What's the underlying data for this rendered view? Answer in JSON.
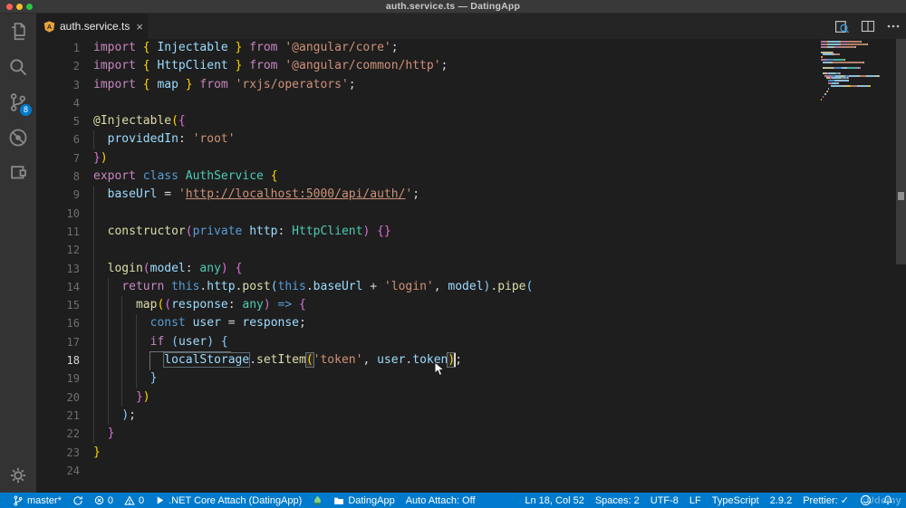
{
  "window": {
    "title": "auth.service.ts — DatingApp"
  },
  "colors": {
    "accent": "#007ACC",
    "badge_bg": "#007ACC",
    "flame": "#89D185",
    "angular_icon": "#E8A33D"
  },
  "palette": {
    "kw": "#C586C0",
    "st": "#569CD6",
    "fn": "#DCDCAA",
    "ty": "#4EC9B0",
    "va": "#9CDCFE",
    "sr": "#CE9178",
    "pu": "#D4D4D4",
    "b1": "#FFD602",
    "b2": "#DA70D6",
    "b3": "#87CEFA"
  },
  "activity_bar": {
    "items": [
      {
        "icon": "files",
        "badge": ""
      },
      {
        "icon": "search",
        "badge": ""
      },
      {
        "icon": "source-control",
        "badge": "8"
      },
      {
        "icon": "debug",
        "badge": ""
      },
      {
        "icon": "extensions",
        "badge": ""
      }
    ],
    "bottom": [
      {
        "icon": "settings",
        "badge": ""
      }
    ]
  },
  "tab": {
    "label": "auth.service.ts",
    "close": "×"
  },
  "editor_actions": [
    {
      "icon": "open-preview"
    },
    {
      "icon": "split-editor"
    },
    {
      "icon": "more-actions"
    }
  ],
  "code": {
    "active_line": 18,
    "lines": [
      {
        "n": 1,
        "i": 0,
        "g": 0,
        "t": [
          [
            "import ",
            "kw"
          ],
          [
            "{",
            "b1"
          ],
          [
            " Injectable ",
            "va"
          ],
          [
            "}",
            "b1"
          ],
          [
            " from ",
            "kw"
          ],
          [
            "'@angular/core'",
            "sr"
          ],
          [
            ";",
            "pu"
          ]
        ]
      },
      {
        "n": 2,
        "i": 0,
        "g": 0,
        "t": [
          [
            "import ",
            "kw"
          ],
          [
            "{",
            "b1"
          ],
          [
            " HttpClient ",
            "va"
          ],
          [
            "}",
            "b1"
          ],
          [
            " from ",
            "kw"
          ],
          [
            "'@angular/common/http'",
            "sr"
          ],
          [
            ";",
            "pu"
          ]
        ]
      },
      {
        "n": 3,
        "i": 0,
        "g": 0,
        "t": [
          [
            "import ",
            "kw"
          ],
          [
            "{",
            "b1"
          ],
          [
            " map ",
            "va"
          ],
          [
            "}",
            "b1"
          ],
          [
            " from ",
            "kw"
          ],
          [
            "'rxjs/operators'",
            "sr"
          ],
          [
            ";",
            "pu"
          ]
        ]
      },
      {
        "n": 4,
        "i": 0,
        "g": 0,
        "t": []
      },
      {
        "n": 5,
        "i": 0,
        "g": 0,
        "t": [
          [
            "@Injectable",
            "fn"
          ],
          [
            "(",
            "b1"
          ],
          [
            "{",
            "b2"
          ]
        ]
      },
      {
        "n": 6,
        "i": 2,
        "g": 1,
        "t": [
          [
            "providedIn",
            "va"
          ],
          [
            ": ",
            "pu"
          ],
          [
            "'root'",
            "sr"
          ]
        ]
      },
      {
        "n": 7,
        "i": 0,
        "g": 0,
        "t": [
          [
            "}",
            "b2"
          ],
          [
            ")",
            "b1"
          ]
        ]
      },
      {
        "n": 8,
        "i": 0,
        "g": 0,
        "t": [
          [
            "export ",
            "kw"
          ],
          [
            "class ",
            "st"
          ],
          [
            "AuthService ",
            "ty"
          ],
          [
            "{",
            "b1"
          ]
        ]
      },
      {
        "n": 9,
        "i": 2,
        "g": 1,
        "t": [
          [
            "baseUrl",
            "va"
          ],
          [
            " = ",
            "pu"
          ],
          [
            "'",
            "sr"
          ],
          [
            "http://localhost:5000/api/auth/",
            "sr",
            "u"
          ],
          [
            "'",
            "sr"
          ],
          [
            ";",
            "pu"
          ]
        ]
      },
      {
        "n": 10,
        "i": 0,
        "g": 1,
        "t": []
      },
      {
        "n": 11,
        "i": 2,
        "g": 1,
        "t": [
          [
            "constructor",
            "fn"
          ],
          [
            "(",
            "b2"
          ],
          [
            "private ",
            "st"
          ],
          [
            "http",
            "va"
          ],
          [
            ": ",
            "pu"
          ],
          [
            "HttpClient",
            "ty"
          ],
          [
            ")",
            "b2"
          ],
          [
            " ",
            "pu"
          ],
          [
            "{}",
            "b2"
          ]
        ]
      },
      {
        "n": 12,
        "i": 0,
        "g": 1,
        "t": []
      },
      {
        "n": 13,
        "i": 2,
        "g": 1,
        "t": [
          [
            "login",
            "fn"
          ],
          [
            "(",
            "b2"
          ],
          [
            "model",
            "va"
          ],
          [
            ": ",
            "pu"
          ],
          [
            "any",
            "ty"
          ],
          [
            ")",
            "b2"
          ],
          [
            " ",
            "pu"
          ],
          [
            "{",
            "b2"
          ]
        ]
      },
      {
        "n": 14,
        "i": 4,
        "g": 2,
        "t": [
          [
            "return ",
            "kw"
          ],
          [
            "this",
            "st"
          ],
          [
            ".",
            "pu"
          ],
          [
            "http",
            "va"
          ],
          [
            ".",
            "pu"
          ],
          [
            "post",
            "fn"
          ],
          [
            "(",
            "b3"
          ],
          [
            "this",
            "st"
          ],
          [
            ".",
            "pu"
          ],
          [
            "baseUrl",
            "va"
          ],
          [
            " + ",
            "pu"
          ],
          [
            "'login'",
            "sr"
          ],
          [
            ", ",
            "pu"
          ],
          [
            "model",
            "va"
          ],
          [
            ")",
            "b3"
          ],
          [
            ".",
            "pu"
          ],
          [
            "pipe",
            "fn"
          ],
          [
            "(",
            "b3"
          ]
        ]
      },
      {
        "n": 15,
        "i": 6,
        "g": 3,
        "t": [
          [
            "map",
            "fn"
          ],
          [
            "(",
            "b1"
          ],
          [
            "(",
            "b2"
          ],
          [
            "response",
            "va"
          ],
          [
            ": ",
            "pu"
          ],
          [
            "any",
            "ty"
          ],
          [
            ")",
            "b2"
          ],
          [
            " ",
            "pu"
          ],
          [
            "=>",
            "st"
          ],
          [
            " ",
            "pu"
          ],
          [
            "{",
            "b2"
          ]
        ]
      },
      {
        "n": 16,
        "i": 8,
        "g": 4,
        "t": [
          [
            "const ",
            "st"
          ],
          [
            "user",
            "va"
          ],
          [
            " = ",
            "pu"
          ],
          [
            "response",
            "va"
          ],
          [
            ";",
            "pu"
          ]
        ]
      },
      {
        "n": 17,
        "i": 8,
        "g": 4,
        "t": [
          [
            "if ",
            "kw"
          ],
          [
            "(",
            "b3"
          ],
          [
            "user",
            "va"
          ],
          [
            ")",
            "b3"
          ],
          [
            " ",
            "pu"
          ],
          [
            "{",
            "b3"
          ]
        ]
      },
      {
        "n": 18,
        "i": 10,
        "g": 4,
        "t": [
          [
            "localStorage",
            "va",
            "w"
          ],
          [
            ".",
            "pu"
          ],
          [
            "setItem",
            "fn"
          ],
          [
            "(",
            "b1",
            "m"
          ],
          [
            "'token'",
            "sr"
          ],
          [
            ", ",
            "pu"
          ],
          [
            "user",
            "va"
          ],
          [
            ".",
            "pu"
          ],
          [
            "token",
            "va"
          ],
          [
            ")",
            "b1",
            "m"
          ],
          [
            ";",
            "pu",
            "c"
          ]
        ]
      },
      {
        "n": 19,
        "i": 8,
        "g": 4,
        "t": [
          [
            "}",
            "b3"
          ]
        ]
      },
      {
        "n": 20,
        "i": 6,
        "g": 3,
        "t": [
          [
            "}",
            "b2"
          ],
          [
            ")",
            "b1"
          ]
        ]
      },
      {
        "n": 21,
        "i": 4,
        "g": 2,
        "t": [
          [
            ")",
            "b3"
          ],
          [
            ";",
            "pu"
          ]
        ]
      },
      {
        "n": 22,
        "i": 2,
        "g": 1,
        "t": [
          [
            "}",
            "b2"
          ]
        ]
      },
      {
        "n": 23,
        "i": 0,
        "g": 0,
        "t": [
          [
            "}",
            "b1"
          ]
        ]
      },
      {
        "n": 24,
        "i": 0,
        "g": 0,
        "t": []
      }
    ]
  },
  "status_bar": {
    "left": [
      {
        "name": "branch",
        "icon": "git-branch",
        "text": "master*"
      },
      {
        "name": "sync",
        "icon": "sync",
        "text": ""
      },
      {
        "name": "errors",
        "icon": "error",
        "text": "0"
      },
      {
        "name": "warnings",
        "icon": "warning",
        "text": "0"
      },
      {
        "name": "debug-target",
        "icon": "play",
        "text": ".NET Core Attach (DatingApp)"
      },
      {
        "name": "flame",
        "icon": "flame",
        "text": ""
      },
      {
        "name": "workspace",
        "icon": "folder",
        "text": "DatingApp"
      },
      {
        "name": "auto-attach",
        "icon": "",
        "text": "Auto Attach: Off"
      }
    ],
    "right": [
      {
        "name": "cursor-position",
        "icon": "",
        "text": "Ln 18, Col 52"
      },
      {
        "name": "indentation",
        "icon": "",
        "text": "Spaces: 2"
      },
      {
        "name": "encoding",
        "icon": "",
        "text": "UTF-8"
      },
      {
        "name": "eol",
        "icon": "",
        "text": "LF"
      },
      {
        "name": "language",
        "icon": "",
        "text": "TypeScript"
      },
      {
        "name": "ts-version",
        "icon": "",
        "text": "2.9.2"
      },
      {
        "name": "prettier",
        "icon": "",
        "text": "Prettier: ✓"
      },
      {
        "name": "feedback",
        "icon": "smiley",
        "text": ""
      },
      {
        "name": "notifications",
        "icon": "bell",
        "text": ""
      }
    ]
  },
  "watermark": "Udemy"
}
